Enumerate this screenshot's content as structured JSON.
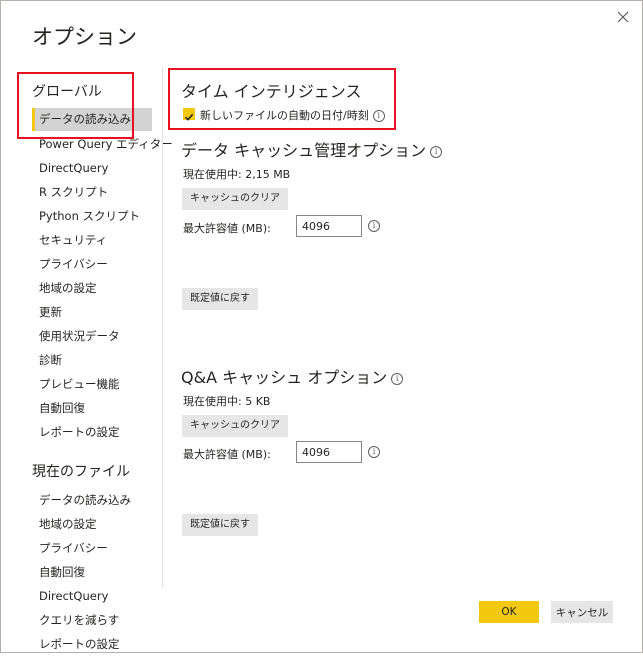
{
  "dialog": {
    "title": "オプション",
    "close_icon": "close-icon"
  },
  "sidebar": {
    "global_heading": "グローバル",
    "global_items": [
      {
        "label": "データの読み込み",
        "selected": true
      },
      {
        "label": "Power Query エディター"
      },
      {
        "label": "DirectQuery"
      },
      {
        "label": "R スクリプト"
      },
      {
        "label": "Python スクリプト"
      },
      {
        "label": "セキュリティ"
      },
      {
        "label": "プライバシー"
      },
      {
        "label": "地域の設定"
      },
      {
        "label": "更新"
      },
      {
        "label": "使用状況データ"
      },
      {
        "label": "診断"
      },
      {
        "label": "プレビュー機能"
      },
      {
        "label": "自動回復"
      },
      {
        "label": "レポートの設定"
      }
    ],
    "current_file_heading": "現在のファイル",
    "current_file_items": [
      {
        "label": "データの読み込み"
      },
      {
        "label": "地域の設定"
      },
      {
        "label": "プライバシー"
      },
      {
        "label": "自動回復"
      },
      {
        "label": "DirectQuery"
      },
      {
        "label": "クエリを減らす"
      },
      {
        "label": "レポートの設定"
      }
    ]
  },
  "main": {
    "time_intelligence": {
      "heading": "タイム インテリジェンス",
      "checkbox_label": "新しいファイルの自動の日付/時刻",
      "checked": true
    },
    "data_cache": {
      "heading": "データ キャッシュ管理オプション",
      "current_usage": "現在使用中: 2,15 MB",
      "clear_button": "キャッシュのクリア",
      "max_label": "最大許容値 (MB):",
      "max_value": "4096",
      "reset_button": "既定値に戻す"
    },
    "qa_cache": {
      "heading": "Q&A キャッシュ オプション",
      "current_usage": "現在使用中: 5 KB",
      "clear_button": "キャッシュのクリア",
      "max_label": "最大許容値 (MB):",
      "max_value": "4096",
      "reset_button": "既定値に戻す"
    }
  },
  "footer": {
    "ok_label": "OK",
    "cancel_label": "キャンセル"
  },
  "colors": {
    "accent": "#f2c811",
    "highlight": "#e81123",
    "button_gray": "#e6e6e6",
    "selected_bg": "#d3d3d3"
  }
}
